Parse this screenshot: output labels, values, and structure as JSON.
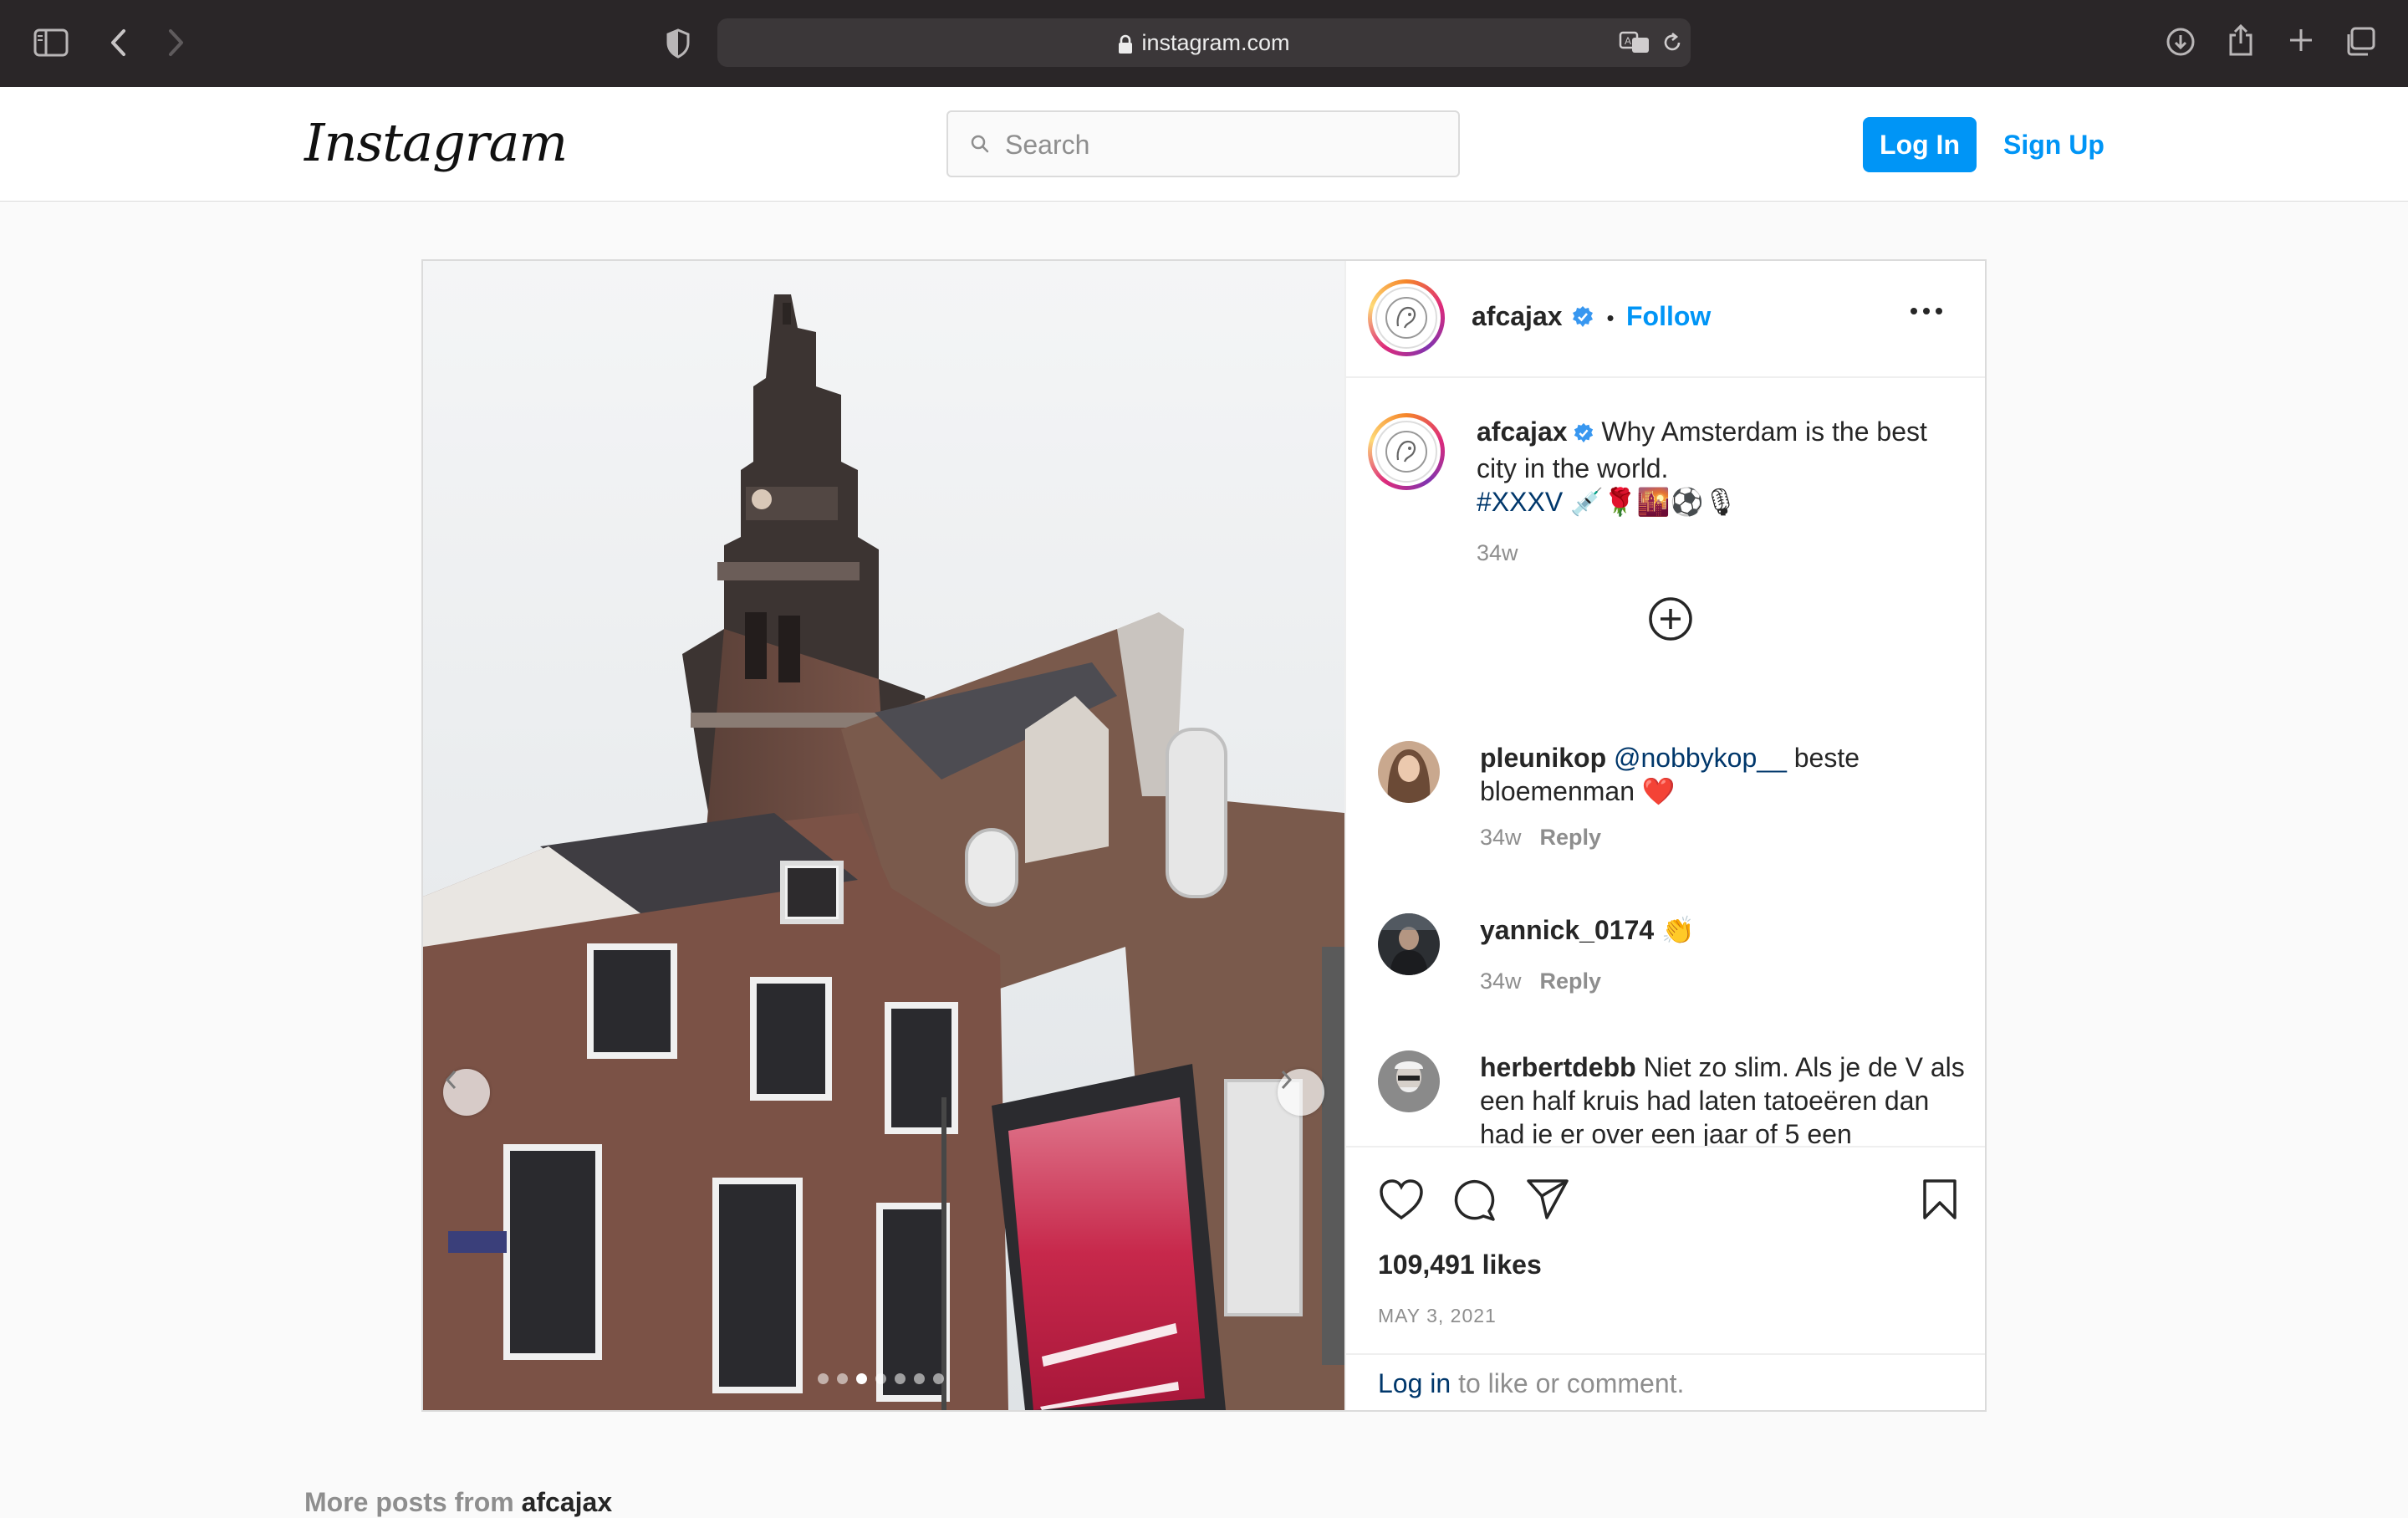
{
  "browser": {
    "url": "instagram.com"
  },
  "header": {
    "logo": "Instagram",
    "search_placeholder": "Search",
    "login_label": "Log In",
    "signup_label": "Sign Up"
  },
  "post": {
    "username": "afcajax",
    "follow_label": "Follow",
    "separator": "•",
    "caption": {
      "username": "afcajax",
      "text": "Why Amsterdam is the best city in the world.",
      "hashtag": "#XXXV",
      "emojis": "💉🌹🌇⚽🎙",
      "time": "34w"
    },
    "comments": [
      {
        "username": "pleunikop",
        "mention": "@nobbykop__",
        "text": "beste bloemenman ❤️",
        "time": "34w",
        "reply_label": "Reply"
      },
      {
        "username": "yannick_0174",
        "text": "👏",
        "time": "34w",
        "reply_label": "Reply"
      },
      {
        "username": "herbertdebb",
        "text": "Niet zo slim. Als je de V als een half kruis had laten tatoeëren dan had ie er over een jaar of 5 een"
      }
    ],
    "likes": "109,491 likes",
    "date": "MAY 3, 2021",
    "login_prompt": {
      "link": "Log in",
      "text": "to like or comment."
    },
    "carousel": {
      "total": 7,
      "active": 3
    }
  },
  "more_posts": {
    "prefix": "More posts from",
    "username": "afcajax"
  },
  "colors": {
    "accent": "#0095f6",
    "link_dark": "#00376b"
  }
}
